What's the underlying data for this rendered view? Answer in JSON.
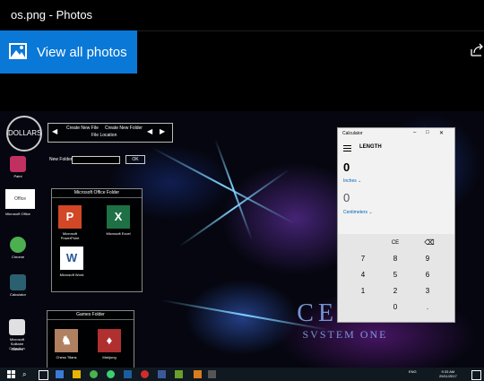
{
  "window": {
    "title": "os.png - Photos"
  },
  "toolbar": {
    "view_all_label": "View all photos"
  },
  "photo": {
    "logo_text": "DOLLARS",
    "file_nav": {
      "create_file": "Create New File",
      "create_folder": "Create New Folder",
      "file_location": "File Location"
    },
    "new_folder_label": "New Folder",
    "ok_label": "OK",
    "desktop_icons": [
      {
        "label": "Paint",
        "color": "#c03060"
      },
      {
        "label": "Microsoft Office",
        "color": "#ffffff"
      },
      {
        "label": "Chrome",
        "color": "#4caf50"
      },
      {
        "label": "Calculator",
        "color": "#2a6070"
      },
      {
        "label": "Microsoft Solitaire Collection",
        "color": "#e0e0e0"
      },
      {
        "label": "Games",
        "color": "#444444"
      }
    ],
    "office_tile_label": "Office",
    "office_folder": {
      "title": "Microsoft Office Folder",
      "apps": [
        {
          "label": "Microsoft PowerPoint",
          "glyph": "P",
          "color": "#d24726"
        },
        {
          "label": "Microsoft Excel",
          "glyph": "X",
          "color": "#1e7145"
        },
        {
          "label": "Microsoft Word",
          "glyph": "W",
          "color": "#ffffff"
        }
      ]
    },
    "games_folder": {
      "title": "Games Folder",
      "apps": [
        {
          "label": "Chess Titans",
          "glyph": "♞",
          "color": "#b08060"
        },
        {
          "label": "Mahjong",
          "glyph": "♦",
          "color": "#b03030"
        }
      ]
    },
    "watermark": {
      "line1": "CELIA",
      "line2": "SVSTEM ONE"
    },
    "clock": {
      "time": "9:33 AM",
      "date": "29/11/2017"
    },
    "tray_lang": "ENG"
  },
  "calculator": {
    "title": "Calculator",
    "mode": "LENGTH",
    "from_value": "0",
    "from_unit": "Inches",
    "to_value": "0",
    "to_unit": "Centimeters",
    "keys": [
      "CE",
      "⌫",
      "7",
      "8",
      "9",
      "4",
      "5",
      "6",
      "1",
      "2",
      "3",
      "0",
      "."
    ]
  },
  "colors": {
    "accent": "#0a78d7"
  }
}
